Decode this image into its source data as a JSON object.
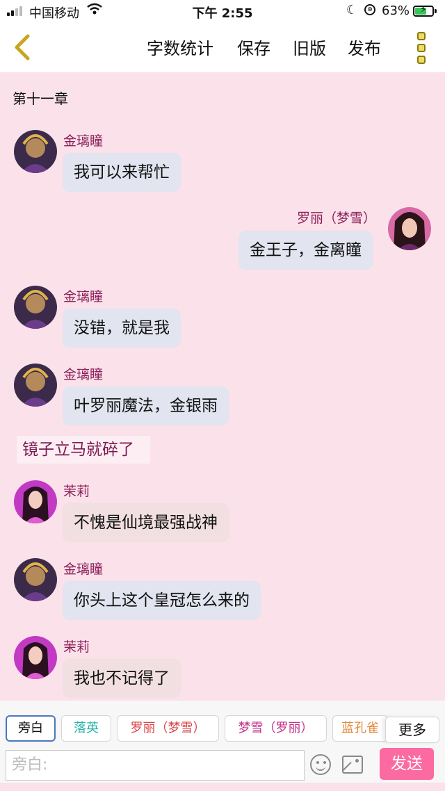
{
  "status_bar": {
    "carrier": "中国移动",
    "time": "下午 2:55",
    "battery_percent": "63%",
    "icons": [
      "signal-icon",
      "wifi-icon",
      "moon-icon",
      "rotation-lock-icon",
      "battery-charging-icon"
    ]
  },
  "nav": {
    "back_icon": "chevron-left-icon",
    "word_count_label": "字数统计",
    "save_label": "保存",
    "old_version_label": "旧版",
    "publish_label": "发布",
    "menu_icon": "vertical-menu-icon"
  },
  "chapter_title": "第十一章",
  "messages": [
    {
      "speaker": "金璃瞳",
      "text": "我可以来帮忙",
      "side": "left"
    },
    {
      "speaker": "罗丽（梦雪）",
      "text": "金王子，金离瞳",
      "side": "right"
    },
    {
      "speaker": "金璃瞳",
      "text": "没错，就是我",
      "side": "left"
    },
    {
      "speaker": "金璃瞳",
      "text": "叶罗丽魔法，金银雨",
      "side": "left"
    },
    {
      "narration": "镜子立马就碎了"
    },
    {
      "speaker": "茉莉",
      "text": "不愧是仙境最强战神",
      "side": "left"
    },
    {
      "speaker": "金璃瞳",
      "text": "你头上这个皇冠怎么来的",
      "side": "left"
    },
    {
      "speaker": "茉莉",
      "text": "我也不记得了",
      "side": "left"
    }
  ],
  "role_chips": [
    {
      "label": "旁白",
      "color": "#111111"
    },
    {
      "label": "落英",
      "color": "#2bb3a8"
    },
    {
      "label": "罗丽（梦雪）",
      "color": "#d9464a"
    },
    {
      "label": "梦雪（罗丽）",
      "color": "#c2338a"
    },
    {
      "label": "蓝孔雀",
      "color": "#e48a3c"
    }
  ],
  "more_label": "更多",
  "input": {
    "placeholder": "旁白:",
    "emoji_icon": "emoji-icon",
    "image_icon": "image-icon",
    "send_label": "发送"
  },
  "colors": {
    "background": "#fbe1e9",
    "speaker_name": "#8b1e5a",
    "send_button": "#fb6aa0"
  }
}
